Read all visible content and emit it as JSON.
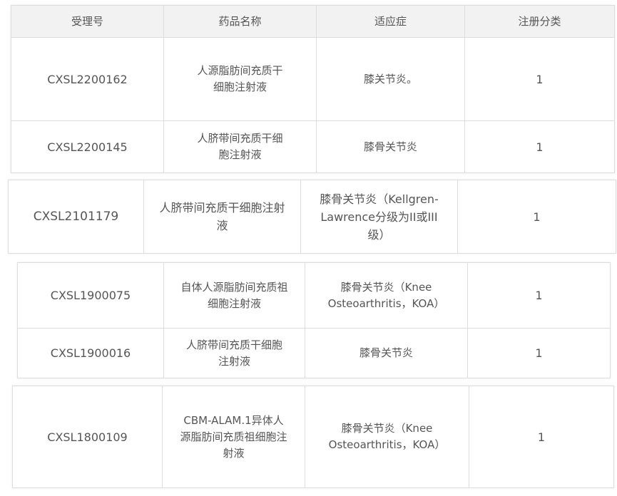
{
  "table": {
    "headers": [
      "受理号",
      "药品名称",
      "适应症",
      "注册分类"
    ],
    "rows": [
      {
        "code": "CXSL2200162",
        "name": "人源脂肪间充质干细胞注射液",
        "indication": "膝关节炎。",
        "class": "1"
      },
      {
        "code": "CXSL2200145",
        "name": "人脐带间充质干细胞注射液",
        "indication": "膝骨关节炎",
        "class": "1"
      },
      {
        "code": "CXSL2101179",
        "name": "人脐带间充质干细胞注射液",
        "indication": "膝骨关节炎（Kellgren-Lawrence分级为II或III级）",
        "class": "1"
      },
      {
        "code": "CXSL1900075",
        "name": "自体人源脂肪间充质祖细胞注射液",
        "indication": "膝骨关节炎（Knee Osteoarthritis，KOA）",
        "class": "1"
      },
      {
        "code": "CXSL1900016",
        "name": "人脐带间充质干细胞注射液",
        "indication": "膝骨关节炎",
        "class": "1"
      },
      {
        "code": "CXSL1800109",
        "name": "CBM-ALAM.1异体人源脂肪间充质祖细胞注射液",
        "indication": "膝骨关节炎（Knee Osteoarthritis，KOA）",
        "class": "1"
      }
    ]
  }
}
